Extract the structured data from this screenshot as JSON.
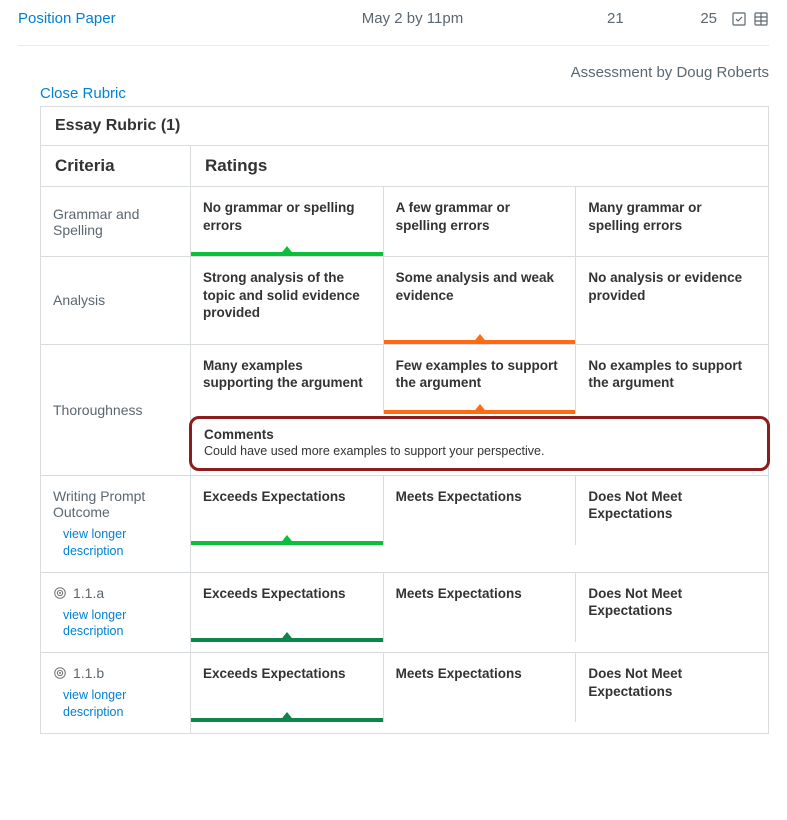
{
  "header": {
    "assignment_title": "Position Paper",
    "due": "May 2 by 11pm",
    "score": "21",
    "out_of": "25"
  },
  "assessor_line": "Assessment by Doug Roberts",
  "close_rubric_label": "Close Rubric",
  "rubric": {
    "title": "Essay Rubric (1)",
    "columns": {
      "criteria": "Criteria",
      "ratings": "Ratings"
    },
    "rows": [
      {
        "criterion": "Grammar and Spelling",
        "view_longer": false,
        "outcome_icon": false,
        "ratings": [
          {
            "label": "No grammar or spelling errors",
            "selected": true,
            "color": "green-bright"
          },
          {
            "label": "A few grammar or spelling errors",
            "selected": false
          },
          {
            "label": "Many grammar or spelling errors",
            "selected": false
          }
        ]
      },
      {
        "criterion": "Analysis",
        "view_longer": false,
        "outcome_icon": false,
        "ratings": [
          {
            "label": "Strong analysis of the topic and solid evidence provided",
            "selected": false
          },
          {
            "label": "Some analysis and weak evidence",
            "selected": true,
            "color": "orange"
          },
          {
            "label": "No analysis or evidence provided",
            "selected": false
          }
        ]
      },
      {
        "criterion": "Thoroughness",
        "view_longer": false,
        "outcome_icon": false,
        "ratings": [
          {
            "label": "Many examples supporting the argument",
            "selected": false
          },
          {
            "label": "Few examples to support the argument",
            "selected": true,
            "color": "orange"
          },
          {
            "label": "No examples to support the argument",
            "selected": false
          }
        ],
        "comments": {
          "label": "Comments",
          "text": "Could have used more examples to support your perspective."
        }
      },
      {
        "criterion": "Writing Prompt Outcome",
        "view_longer": true,
        "view_longer_label": "view longer description",
        "outcome_icon": false,
        "ratings": [
          {
            "label": "Exceeds Expectations",
            "selected": true,
            "color": "green-bright"
          },
          {
            "label": "Meets Expectations",
            "selected": false
          },
          {
            "label": "Does Not Meet Expectations",
            "selected": false
          }
        ]
      },
      {
        "criterion": "1.1.a",
        "view_longer": true,
        "view_longer_label": "view longer description",
        "outcome_icon": true,
        "ratings": [
          {
            "label": "Exceeds Expectations",
            "selected": true,
            "color": "green"
          },
          {
            "label": "Meets Expectations",
            "selected": false
          },
          {
            "label": "Does Not Meet Expectations",
            "selected": false
          }
        ]
      },
      {
        "criterion": "1.1.b",
        "view_longer": true,
        "view_longer_label": "view longer description",
        "outcome_icon": true,
        "ratings": [
          {
            "label": "Exceeds Expectations",
            "selected": true,
            "color": "green"
          },
          {
            "label": "Meets Expectations",
            "selected": false
          },
          {
            "label": "Does Not Meet Expectations",
            "selected": false
          }
        ]
      }
    ]
  }
}
